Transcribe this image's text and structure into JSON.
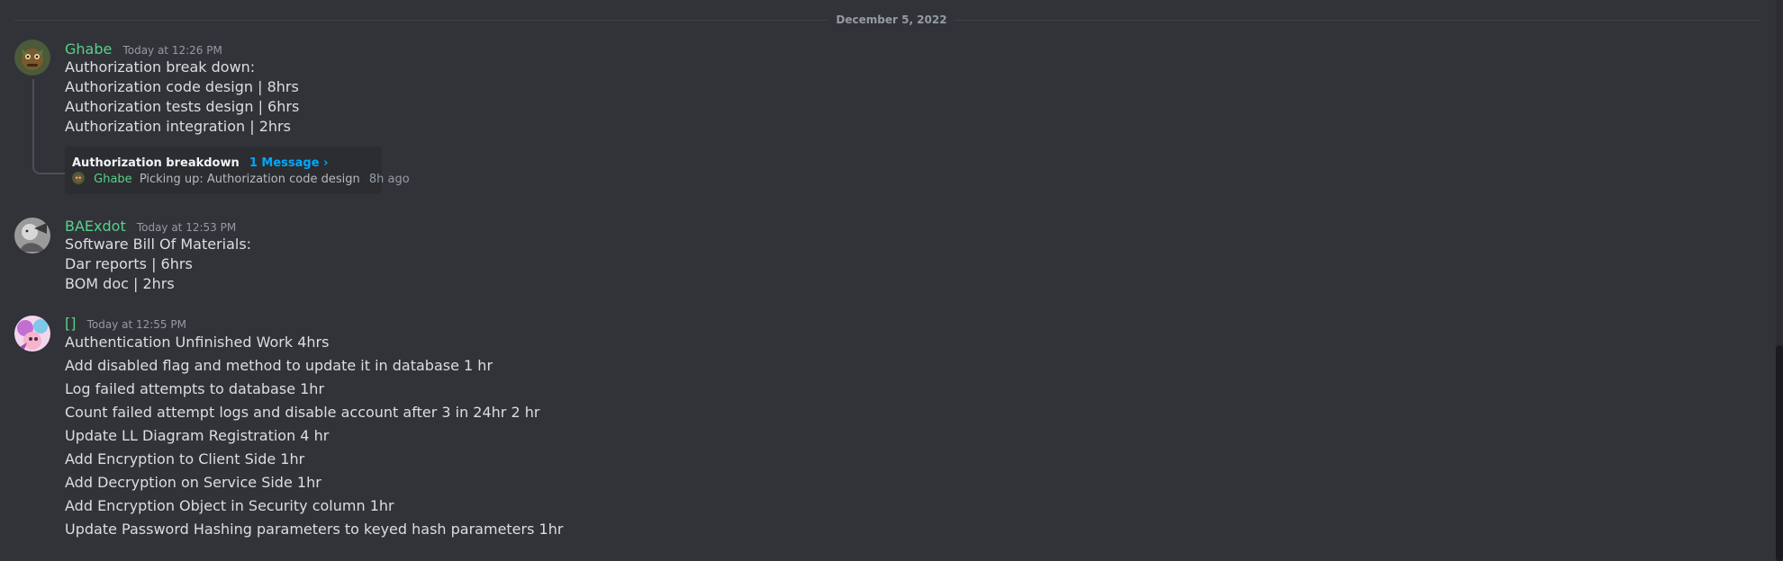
{
  "divider": {
    "date": "December 5, 2022"
  },
  "messages": [
    {
      "author": "Ghabe",
      "timestamp": "Today at 12:26 PM",
      "lines": [
        "Authorization break down:",
        "Authorization code design | 8hrs",
        "Authorization tests design | 6hrs",
        "Authorization integration | 2hrs"
      ],
      "thread": {
        "name": "Authorization breakdown",
        "count": "1 Message ›",
        "last_author": "Ghabe",
        "last_preview": "Picking up: Authorization code design",
        "last_time": "8h ago"
      }
    },
    {
      "author": "BAExdot",
      "timestamp": "Today at 12:53 PM",
      "lines": [
        "Software Bill Of Materials:",
        "Dar reports | 6hrs",
        "BOM doc | 2hrs"
      ]
    },
    {
      "author": "[]",
      "timestamp": "Today at 12:55 PM",
      "lines": [
        "Authentication Unfinished Work 4hrs",
        "Add disabled flag and method to update it in database 1 hr",
        "Log failed attempts to database 1hr",
        "Count failed attempt logs and disable account after 3 in 24hr 2 hr",
        "Update LL Diagram Registration 4 hr",
        "Add Encryption to Client Side 1hr",
        "Add Decryption on Service Side 1hr",
        "Add Encryption Object in Security column 1hr",
        "Update Password Hashing parameters to keyed hash parameters 1hr"
      ]
    }
  ],
  "colors": {
    "background": "#313338",
    "author": "#57d18a",
    "link": "#00a8fc",
    "text": "#dbdee1",
    "muted": "#949ba4"
  }
}
